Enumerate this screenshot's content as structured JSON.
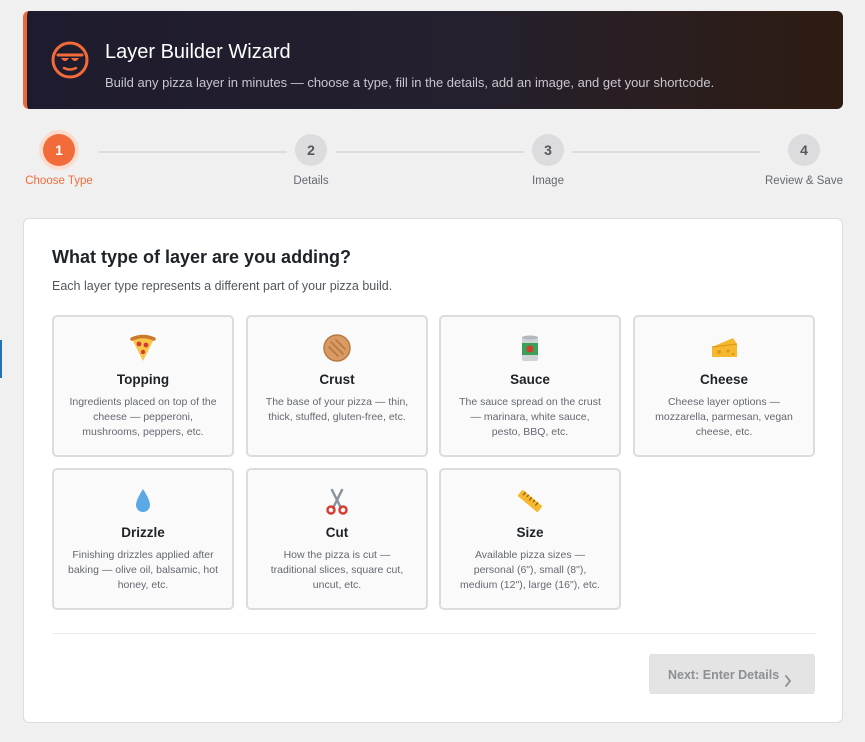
{
  "header": {
    "title": "Layer Builder Wizard",
    "subtitle": "Build any pizza layer in minutes — choose a type, fill in the details, add an image, and get your shortcode.",
    "logo_icon": "pizza-face-logo-icon"
  },
  "steps": [
    {
      "number": "1",
      "label": "Choose Type",
      "active": true
    },
    {
      "number": "2",
      "label": "Details",
      "active": false
    },
    {
      "number": "3",
      "label": "Image",
      "active": false
    },
    {
      "number": "4",
      "label": "Review & Save",
      "active": false
    }
  ],
  "content": {
    "heading": "What type of layer are you adding?",
    "intro": "Each layer type represents a different part of your pizza build.",
    "types": [
      {
        "name": "Topping",
        "icon": "pizza-slice-icon",
        "description": "Ingredients placed on top of the cheese — pepperoni, mushrooms, peppers, etc."
      },
      {
        "name": "Crust",
        "icon": "crust-icon",
        "description": "The base of your pizza — thin, thick, stuffed, gluten-free, etc."
      },
      {
        "name": "Sauce",
        "icon": "sauce-can-icon",
        "description": "The sauce spread on the crust — marinara, white sauce, pesto, BBQ, etc."
      },
      {
        "name": "Cheese",
        "icon": "cheese-icon",
        "description": "Cheese layer options — mozzarella, parmesan, vegan cheese, etc."
      },
      {
        "name": "Drizzle",
        "icon": "droplet-icon",
        "description": "Finishing drizzles applied after baking — olive oil, balsamic, hot honey, etc."
      },
      {
        "name": "Cut",
        "icon": "scissors-icon",
        "description": "How the pizza is cut — traditional slices, square cut, uncut, etc."
      },
      {
        "name": "Size",
        "icon": "ruler-icon",
        "description": "Available pizza sizes — personal (6\"), small (8\"), medium (12\"), large (16\"), etc."
      }
    ]
  },
  "actions": {
    "next_label": "Next: Enter Details",
    "next_icon": "chevron-right-icon"
  },
  "colors": {
    "accent": "#f26b3a",
    "header_bg": "#1e1b2e",
    "disabled_button": "#e4e4e4"
  }
}
